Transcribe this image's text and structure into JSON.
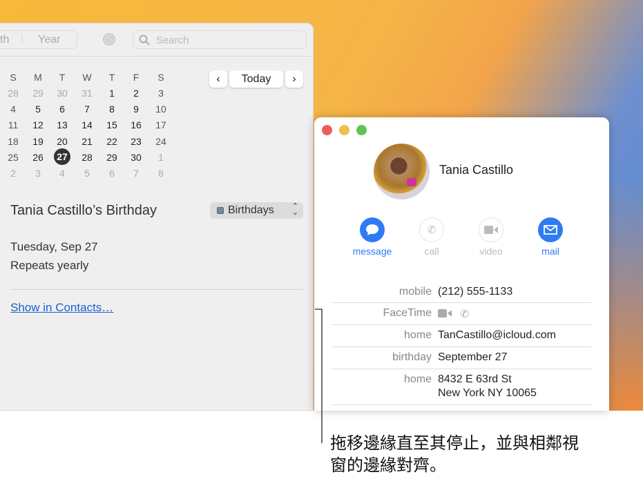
{
  "calendar": {
    "toolbar": {
      "month_partial": "th",
      "year": "Year",
      "search_placeholder": "Search"
    },
    "weekdays": [
      "S",
      "M",
      "T",
      "W",
      "T",
      "F",
      "S"
    ],
    "weeks": [
      [
        "28",
        "29",
        "30",
        "31",
        "1",
        "2",
        "3"
      ],
      [
        "4",
        "5",
        "6",
        "7",
        "8",
        "9",
        "10"
      ],
      [
        "11",
        "12",
        "13",
        "14",
        "15",
        "16",
        "17"
      ],
      [
        "18",
        "19",
        "20",
        "21",
        "22",
        "23",
        "24"
      ],
      [
        "25",
        "26",
        "27",
        "28",
        "29",
        "30",
        "1"
      ],
      [
        "2",
        "3",
        "4",
        "5",
        "6",
        "7",
        "8"
      ]
    ],
    "selected_day": "27",
    "today": "Today",
    "event": {
      "title": "Tania Castillo’s Birthday",
      "calendar": "Birthdays",
      "calendar_color": "#7a8699",
      "date": "Tuesday, Sep 27",
      "repeat": "Repeats yearly",
      "link": "Show in Contacts…"
    }
  },
  "contact": {
    "name": "Tania Castillo",
    "actions": [
      {
        "label": "message",
        "enabled": true
      },
      {
        "label": "call",
        "enabled": false
      },
      {
        "label": "video",
        "enabled": false
      },
      {
        "label": "mail",
        "enabled": true
      }
    ],
    "fields": [
      {
        "label": "mobile",
        "value": "(212) 555-1133"
      },
      {
        "label": "FaceTime",
        "value": ""
      },
      {
        "label": "home",
        "value": "TanCastillo@icloud.com"
      },
      {
        "label": "birthday",
        "value": "September 27"
      },
      {
        "label": "home",
        "value": "8432 E 63rd St",
        "value2": "New York NY 10065"
      }
    ]
  },
  "caption": {
    "line1": "拖移邊緣直至其停止，並與相鄰視",
    "line2": "窗的邊緣對齊。"
  },
  "colors": {
    "accent": "#2f7bf5"
  }
}
